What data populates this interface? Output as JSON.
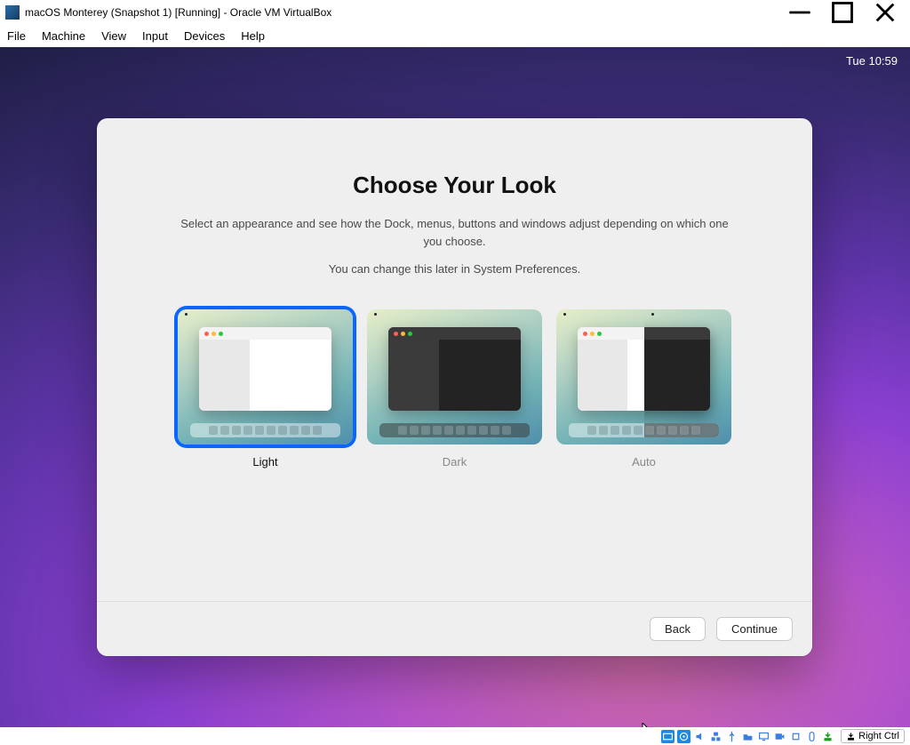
{
  "window": {
    "title": "macOS Monterey (Snapshot 1) [Running] - Oracle VM VirtualBox"
  },
  "menu": {
    "file": "File",
    "machine": "Machine",
    "view": "View",
    "input": "Input",
    "devices": "Devices",
    "help": "Help"
  },
  "guest": {
    "clock": "Tue 10:59"
  },
  "setup": {
    "title": "Choose Your Look",
    "description": "Select an appearance and see how the Dock, menus, buttons and windows adjust depending on which one you choose.",
    "subtext": "You can change this later in System Preferences.",
    "options": {
      "light": "Light",
      "dark": "Dark",
      "auto": "Auto"
    },
    "selected": "light",
    "buttons": {
      "back": "Back",
      "continue": "Continue"
    }
  },
  "statusbar": {
    "host_key": "Right Ctrl"
  }
}
